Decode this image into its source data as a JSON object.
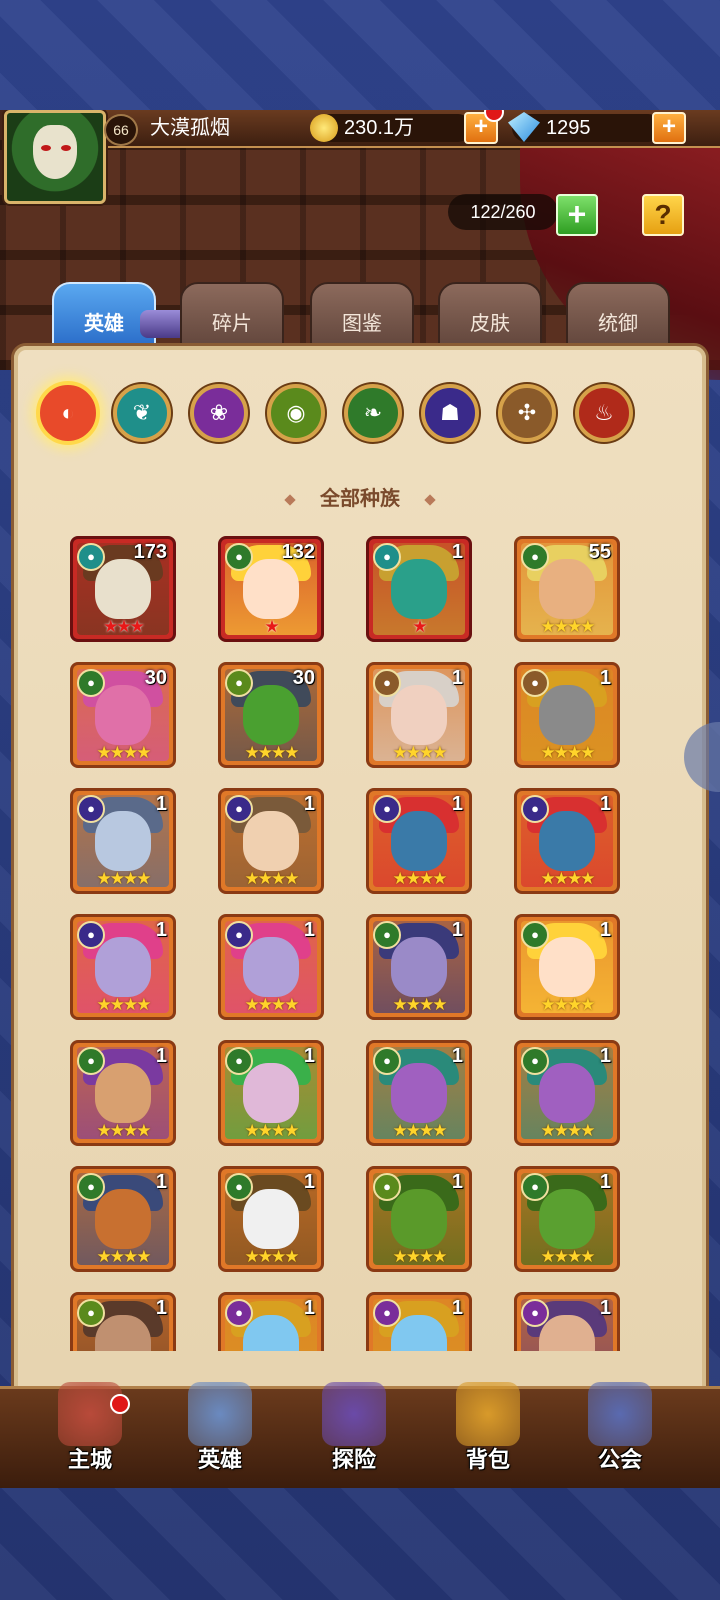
{
  "player": {
    "level": "66",
    "name": "大漠孤烟"
  },
  "resources": {
    "gold": "230.1万",
    "gold_plus": "+",
    "gems": "1295",
    "gems_plus": "+"
  },
  "capacity": {
    "text": "122/260",
    "plus": "+"
  },
  "help": "?",
  "tabs": [
    "英雄",
    "碎片",
    "图鉴",
    "皮肤",
    "统御"
  ],
  "active_tab": "英雄",
  "factions": [
    {
      "name": "all-factions",
      "color": "#e84a2a"
    },
    {
      "name": "shadow-faction",
      "color": "#1f8f8a"
    },
    {
      "name": "fortress-faction",
      "color": "#7a2d9a"
    },
    {
      "name": "abyss-faction",
      "color": "#5a8a1c"
    },
    {
      "name": "forest-faction",
      "color": "#2f7a2a"
    },
    {
      "name": "dark-faction",
      "color": "#3a2a8a"
    },
    {
      "name": "light-faction",
      "color": "#8a5a2a"
    },
    {
      "name": "chaos-faction",
      "color": "#b02a1a"
    }
  ],
  "race_title": "全部种族",
  "heroes": [
    {
      "level": "173",
      "stars": "★★★",
      "red": true,
      "faction": "shadow",
      "fc": "#1f8f8a",
      "skin": "#e8e0cc",
      "hair": "#6a3a20"
    },
    {
      "level": "132",
      "stars": "★",
      "red": true,
      "faction": "forest",
      "fc": "#2f7a2a",
      "skin": "#ffe0c8",
      "hair": "#ffd23a"
    },
    {
      "level": "1",
      "stars": "★",
      "red": true,
      "faction": "shadow",
      "fc": "#1f8f8a",
      "skin": "#2aa08a",
      "hair": "#c8a030"
    },
    {
      "level": "55",
      "stars": "★★★★",
      "red": false,
      "faction": "forest",
      "fc": "#2f7a2a",
      "skin": "#e8b080",
      "hair": "#e8d060"
    },
    {
      "level": "30",
      "stars": "★★★★",
      "red": false,
      "faction": "forest",
      "fc": "#2f7a2a",
      "skin": "#e070a8",
      "hair": "#d050a0"
    },
    {
      "level": "30",
      "stars": "★★★★",
      "red": false,
      "faction": "abyss",
      "fc": "#5a8a1c",
      "skin": "#4aa030",
      "hair": "#404a5a"
    },
    {
      "level": "1",
      "stars": "★★★★",
      "red": false,
      "faction": "light",
      "fc": "#8a5a2a",
      "skin": "#f0d0c0",
      "hair": "#d8d0c8"
    },
    {
      "level": "1",
      "stars": "★★★★",
      "red": false,
      "faction": "light",
      "fc": "#8a5a2a",
      "skin": "#8a8a8a",
      "hair": "#d8a020"
    },
    {
      "level": "1",
      "stars": "★★★★",
      "red": false,
      "faction": "dark",
      "fc": "#3a2a8a",
      "skin": "#b8c8e0",
      "hair": "#5a6a8a"
    },
    {
      "level": "1",
      "stars": "★★★★",
      "red": false,
      "faction": "dark",
      "fc": "#3a2a8a",
      "skin": "#f0d0b0",
      "hair": "#7a5a3a"
    },
    {
      "level": "1",
      "stars": "★★★★",
      "red": false,
      "faction": "dark",
      "fc": "#3a2a8a",
      "skin": "#3a7aa8",
      "hair": "#d83030"
    },
    {
      "level": "1",
      "stars": "★★★★",
      "red": false,
      "faction": "dark",
      "fc": "#3a2a8a",
      "skin": "#3a7aa8",
      "hair": "#d83030"
    },
    {
      "level": "1",
      "stars": "★★★★",
      "red": false,
      "faction": "dark",
      "fc": "#3a2a8a",
      "skin": "#b0a0d8",
      "hair": "#e0408a"
    },
    {
      "level": "1",
      "stars": "★★★★",
      "red": false,
      "faction": "dark",
      "fc": "#3a2a8a",
      "skin": "#b0a0d8",
      "hair": "#e0408a"
    },
    {
      "level": "1",
      "stars": "★★★★",
      "red": false,
      "faction": "forest",
      "fc": "#2f7a2a",
      "skin": "#9a8ac8",
      "hair": "#3a3a7a"
    },
    {
      "level": "1",
      "stars": "★★★★",
      "red": false,
      "faction": "forest",
      "fc": "#2f7a2a",
      "skin": "#ffe0c8",
      "hair": "#ffd23a"
    },
    {
      "level": "1",
      "stars": "★★★★",
      "red": false,
      "faction": "forest",
      "fc": "#2f7a2a",
      "skin": "#d8a070",
      "hair": "#7a3aa0"
    },
    {
      "level": "1",
      "stars": "★★★★",
      "red": false,
      "faction": "forest",
      "fc": "#2f7a2a",
      "skin": "#e0b8d8",
      "hair": "#3ab04a"
    },
    {
      "level": "1",
      "stars": "★★★★",
      "red": false,
      "faction": "forest",
      "fc": "#2f7a2a",
      "skin": "#a060c0",
      "hair": "#2a8a7a"
    },
    {
      "level": "1",
      "stars": "★★★★",
      "red": false,
      "faction": "forest",
      "fc": "#2f7a2a",
      "skin": "#a060c0",
      "hair": "#2a8a7a"
    },
    {
      "level": "1",
      "stars": "★★★★",
      "red": false,
      "faction": "forest",
      "fc": "#2f7a2a",
      "skin": "#c87030",
      "hair": "#3a4a7a"
    },
    {
      "level": "1",
      "stars": "★★★★",
      "red": false,
      "faction": "forest",
      "fc": "#2f7a2a",
      "skin": "#f0f0f0",
      "hair": "#6a4a20"
    },
    {
      "level": "1",
      "stars": "★★★★",
      "red": false,
      "faction": "abyss",
      "fc": "#5a8a1c",
      "skin": "#5a9a2a",
      "hair": "#3a6a1a"
    },
    {
      "level": "1",
      "stars": "★★★★",
      "red": false,
      "faction": "forest",
      "fc": "#2f7a2a",
      "skin": "#5aa030",
      "hair": "#3a6a1a"
    },
    {
      "level": "1",
      "stars": "",
      "red": false,
      "faction": "abyss",
      "fc": "#5a8a1c",
      "skin": "#c09070",
      "hair": "#5a3a2a"
    },
    {
      "level": "1",
      "stars": "",
      "red": false,
      "faction": "fortress",
      "fc": "#7a2d9a",
      "skin": "#80c8f0",
      "hair": "#d8a020"
    },
    {
      "level": "1",
      "stars": "",
      "red": false,
      "faction": "fortress",
      "fc": "#7a2d9a",
      "skin": "#80c8f0",
      "hair": "#d8a020"
    },
    {
      "level": "1",
      "stars": "",
      "red": false,
      "faction": "fortress",
      "fc": "#7a2d9a",
      "skin": "#e0b090",
      "hair": "#5a3a7a"
    }
  ],
  "nav": [
    {
      "label": "主城",
      "color": "#b84a3a"
    },
    {
      "label": "英雄",
      "color": "#6a8ac0"
    },
    {
      "label": "探险",
      "color": "#6a4aa8"
    },
    {
      "label": "背包",
      "color": "#d89a2a"
    },
    {
      "label": "公会",
      "color": "#5a6ab0"
    }
  ]
}
